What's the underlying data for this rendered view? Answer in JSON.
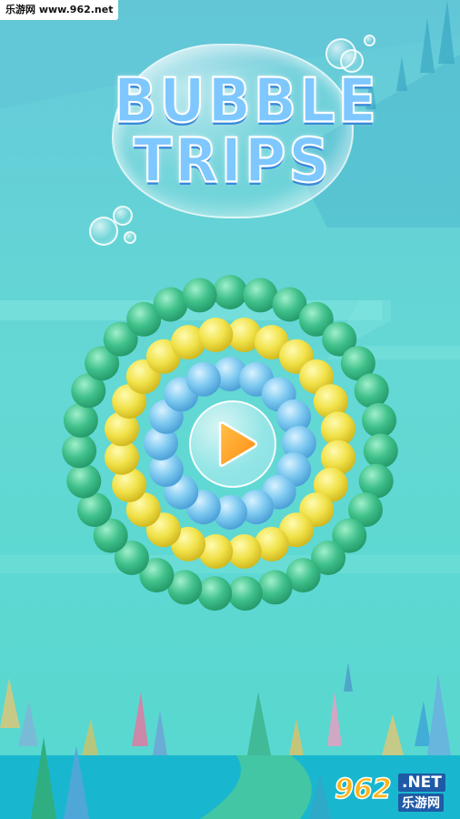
{
  "watermark": {
    "top_text": "乐游网 www.962.net",
    "badge_num": "962",
    "badge_net": ".NET",
    "badge_sub": "乐游网"
  },
  "title": {
    "line1": "BUBBLE",
    "line2": "TRIPS"
  },
  "play_icon": "play-triangle",
  "colors": {
    "sky": "#5fd9d6",
    "green": "#3fc08a",
    "yellow": "#f1e24a",
    "blue": "#7cc8f0",
    "play": "#ff9a1f"
  },
  "rings": [
    {
      "color": "green",
      "count": 31,
      "stagger": false
    },
    {
      "color": "yellow",
      "count": 24,
      "stagger": true
    },
    {
      "color": "blue",
      "count": 16,
      "stagger": false
    }
  ]
}
